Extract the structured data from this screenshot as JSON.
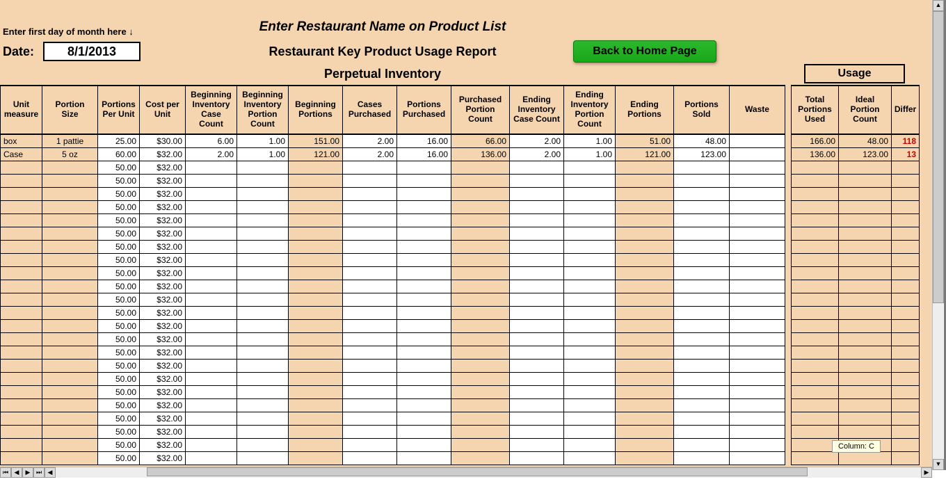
{
  "top": {
    "hint": "Enter first day of month here ↓",
    "date_label": "Date:",
    "date_value": "8/1/2013",
    "title1": "Enter Restaurant Name on Product List",
    "title2": "Restaurant Key Product Usage Report",
    "section_label": "Perpetual Inventory",
    "usage_label": "Usage",
    "home_btn": "Back to Home Page"
  },
  "columns": [
    {
      "key": "unit_measure",
      "label": "Unit measure",
      "w": 60,
      "peach": true,
      "align": "left"
    },
    {
      "key": "portion_size",
      "label": "Portion Size",
      "w": 80,
      "peach": true,
      "align": "center"
    },
    {
      "key": "portions_per_unit",
      "label": "Portions Per Unit",
      "w": 60,
      "peach": false,
      "align": "right"
    },
    {
      "key": "cost_per_unit",
      "label": "Cost per Unit",
      "w": 66,
      "peach": false,
      "align": "right"
    },
    {
      "key": "beg_inv_case",
      "label": "Beginning Inventory Case Count",
      "w": 74,
      "peach": false,
      "align": "right"
    },
    {
      "key": "beg_inv_portion",
      "label": "Beginning Inventory Portion Count",
      "w": 74,
      "peach": false,
      "align": "right"
    },
    {
      "key": "beg_portions",
      "label": "Beginning Portions",
      "w": 78,
      "peach": true,
      "align": "right"
    },
    {
      "key": "cases_purchased",
      "label": "Cases Purchased",
      "w": 78,
      "peach": false,
      "align": "right"
    },
    {
      "key": "portions_purchased",
      "label": "Portions Purchased",
      "w": 78,
      "peach": false,
      "align": "right"
    },
    {
      "key": "purchased_portion_count",
      "label": "Purchased Portion Count",
      "w": 84,
      "peach": true,
      "align": "right"
    },
    {
      "key": "end_inv_case",
      "label": "Ending Inventory Case Count",
      "w": 78,
      "peach": false,
      "align": "right"
    },
    {
      "key": "end_inv_portion",
      "label": "Ending Inventory Portion Count",
      "w": 74,
      "peach": false,
      "align": "right"
    },
    {
      "key": "end_portions",
      "label": "Ending Portions",
      "w": 84,
      "peach": true,
      "align": "right"
    },
    {
      "key": "portions_sold",
      "label": "Portions Sold",
      "w": 80,
      "peach": false,
      "align": "right"
    },
    {
      "key": "waste",
      "label": "Waste",
      "w": 80,
      "peach": false,
      "align": "right"
    },
    {
      "key": "gap",
      "label": "",
      "w": 8,
      "peach": true,
      "align": "",
      "gap": true
    },
    {
      "key": "total_portions_used",
      "label": "Total Portions Used",
      "w": 68,
      "peach": true,
      "align": "right"
    },
    {
      "key": "ideal_portion_count",
      "label": "Ideal Portion Count",
      "w": 76,
      "peach": true,
      "align": "right"
    },
    {
      "key": "difference",
      "label": "Differ",
      "w": 40,
      "peach": true,
      "align": "right",
      "red": true
    }
  ],
  "rows": [
    {
      "unit_measure": "box",
      "portion_size": "1 pattie",
      "portions_per_unit": "25.00",
      "cost_per_unit": "$30.00",
      "beg_inv_case": "6.00",
      "beg_inv_portion": "1.00",
      "beg_portions": "151.00",
      "cases_purchased": "2.00",
      "portions_purchased": "16.00",
      "purchased_portion_count": "66.00",
      "end_inv_case": "2.00",
      "end_inv_portion": "1.00",
      "end_portions": "51.00",
      "portions_sold": "48.00",
      "waste": "",
      "total_portions_used": "166.00",
      "ideal_portion_count": "48.00",
      "difference": "118"
    },
    {
      "unit_measure": "Case",
      "portion_size": "5 oz",
      "portions_per_unit": "60.00",
      "cost_per_unit": "$32.00",
      "beg_inv_case": "2.00",
      "beg_inv_portion": "1.00",
      "beg_portions": "121.00",
      "cases_purchased": "2.00",
      "portions_purchased": "16.00",
      "purchased_portion_count": "136.00",
      "end_inv_case": "2.00",
      "end_inv_portion": "1.00",
      "end_portions": "121.00",
      "portions_sold": "123.00",
      "waste": "",
      "total_portions_used": "136.00",
      "ideal_portion_count": "123.00",
      "difference": "13"
    },
    {
      "portions_per_unit": "50.00",
      "cost_per_unit": "$32.00"
    },
    {
      "portions_per_unit": "50.00",
      "cost_per_unit": "$32.00"
    },
    {
      "portions_per_unit": "50.00",
      "cost_per_unit": "$32.00"
    },
    {
      "portions_per_unit": "50.00",
      "cost_per_unit": "$32.00"
    },
    {
      "portions_per_unit": "50.00",
      "cost_per_unit": "$32.00"
    },
    {
      "portions_per_unit": "50.00",
      "cost_per_unit": "$32.00"
    },
    {
      "portions_per_unit": "50.00",
      "cost_per_unit": "$32.00"
    },
    {
      "portions_per_unit": "50.00",
      "cost_per_unit": "$32.00"
    },
    {
      "portions_per_unit": "50.00",
      "cost_per_unit": "$32.00"
    },
    {
      "portions_per_unit": "50.00",
      "cost_per_unit": "$32.00"
    },
    {
      "portions_per_unit": "50.00",
      "cost_per_unit": "$32.00"
    },
    {
      "portions_per_unit": "50.00",
      "cost_per_unit": "$32.00"
    },
    {
      "portions_per_unit": "50.00",
      "cost_per_unit": "$32.00"
    },
    {
      "portions_per_unit": "50.00",
      "cost_per_unit": "$32.00"
    },
    {
      "portions_per_unit": "50.00",
      "cost_per_unit": "$32.00"
    },
    {
      "portions_per_unit": "50.00",
      "cost_per_unit": "$32.00"
    },
    {
      "portions_per_unit": "50.00",
      "cost_per_unit": "$32.00"
    },
    {
      "portions_per_unit": "50.00",
      "cost_per_unit": "$32.00"
    },
    {
      "portions_per_unit": "50.00",
      "cost_per_unit": "$32.00"
    },
    {
      "portions_per_unit": "50.00",
      "cost_per_unit": "$32.00"
    },
    {
      "portions_per_unit": "50.00",
      "cost_per_unit": "$32.00"
    },
    {
      "portions_per_unit": "50.00",
      "cost_per_unit": "$32.00"
    },
    {
      "portions_per_unit": "50.00",
      "cost_per_unit": "$32.00"
    }
  ],
  "tooltip": "Column: C",
  "nav_icons": [
    "⏮",
    "◀",
    "▶",
    "⏭"
  ]
}
